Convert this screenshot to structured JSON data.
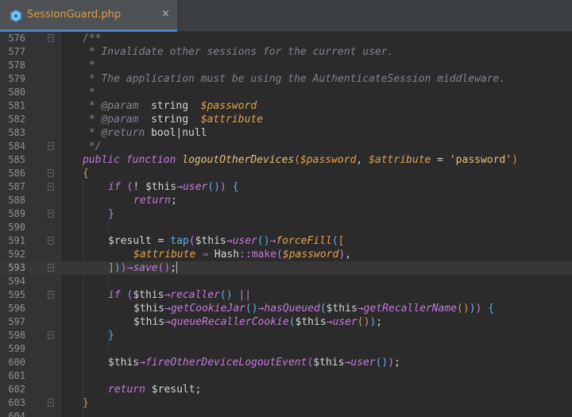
{
  "tab": {
    "filename": "SessionGuard.php",
    "close_symbol": "×",
    "icon": "php-file-icon"
  },
  "editor": {
    "current_line": 593,
    "lines": [
      {
        "n": "576"
      },
      {
        "n": "577"
      },
      {
        "n": "578"
      },
      {
        "n": "579"
      },
      {
        "n": "580"
      },
      {
        "n": "581"
      },
      {
        "n": "582"
      },
      {
        "n": "583"
      },
      {
        "n": "584"
      },
      {
        "n": "585"
      },
      {
        "n": "586"
      },
      {
        "n": "587"
      },
      {
        "n": "588"
      },
      {
        "n": "589"
      },
      {
        "n": "590"
      },
      {
        "n": "591"
      },
      {
        "n": "592"
      },
      {
        "n": "593"
      },
      {
        "n": "594"
      },
      {
        "n": "595"
      },
      {
        "n": "596"
      },
      {
        "n": "597"
      },
      {
        "n": "598"
      },
      {
        "n": "599"
      },
      {
        "n": "600"
      },
      {
        "n": "601"
      },
      {
        "n": "602"
      },
      {
        "n": "603"
      },
      {
        "n": "604"
      }
    ],
    "code": {
      "l576": "/**",
      "l577": " * Invalidate other sessions for the current user.",
      "l578": " *",
      "l579": " * The application must be using the AuthenticateSession middleware.",
      "l580": " *",
      "l581a": " * @param  ",
      "l581b": "string",
      "l581c": "  $password",
      "l582a": " * @param  ",
      "l582b": "string",
      "l582c": "  $attribute",
      "l583a": " * @return ",
      "l583b": "bool|null",
      "l584": " */",
      "public": "public",
      "function": "function",
      "fname": "logoutOtherDevices",
      "password": "$password",
      "attribute": "$attribute",
      "pwstr": "'password'",
      "if": "if",
      "this": "$this",
      "user": "user",
      "return": "return",
      "result": "$result",
      "tap": "tap",
      "forceFill": "forceFill",
      "hash": "Hash",
      "make": "make",
      "save": "save",
      "recaller": "recaller",
      "getCookieJar": "getCookieJar",
      "hasQueued": "hasQueued",
      "getRecallerName": "getRecallerName",
      "queueRecallerCookie": "queueRecallerCookie",
      "fireEvent": "fireOtherDeviceLogoutEvent"
    }
  },
  "colors": {
    "background": "#2b2b2b",
    "gutter": "#313335",
    "tab_accent": "#4a88c7",
    "tab_text": "#e09a45",
    "keyword": "#cc7832",
    "function": "#ffc66d",
    "variable": "#9876aa",
    "doc_comment": "#629755"
  }
}
